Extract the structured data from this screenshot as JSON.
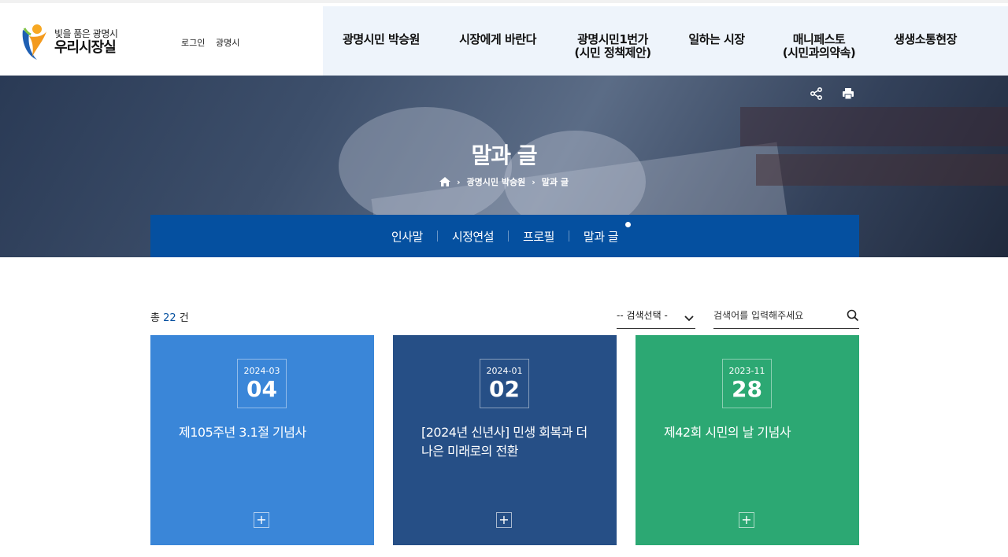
{
  "header": {
    "logo_sub": "빛을 품은 광명시",
    "logo_main": "우리시장실",
    "login_label": "로그인",
    "city_label": "광명시",
    "nav": [
      {
        "line1": "광명시민 박승원",
        "line2": ""
      },
      {
        "line1": "시장에게 바란다",
        "line2": ""
      },
      {
        "line1": "광명시민1번가",
        "line2": "(시민 정책제안)"
      },
      {
        "line1": "일하는 시장",
        "line2": ""
      },
      {
        "line1": "매니페스토",
        "line2": "(시민과의약속)"
      },
      {
        "line1": "생생소통현장",
        "line2": ""
      }
    ]
  },
  "visual": {
    "title": "말과 글",
    "breadcrumb": [
      "광명시민 박승원",
      "말과 글"
    ],
    "icons": [
      "home-icon",
      "share-icon",
      "print-icon"
    ]
  },
  "sub_nav": {
    "items": [
      "인사말",
      "시정연설",
      "프로필",
      "말과 글"
    ],
    "active_index": 3
  },
  "list": {
    "count_prefix": "총",
    "count_value": "22",
    "count_suffix": "건",
    "search_select": "-- 검색선택 -",
    "search_placeholder": "검색어를 입력해주세요"
  },
  "cards": [
    {
      "ym": "2024-03",
      "day": "04",
      "title": "제105주년 3.1절 기념사",
      "color": "#3a86d8"
    },
    {
      "ym": "2024-01",
      "day": "02",
      "title": "[2024년 신년사] 민생 회복과 더 나은 미래로의 전환",
      "color": "#264f86"
    },
    {
      "ym": "2023-11",
      "day": "28",
      "title": "제42회 시민의 날 기념사",
      "color": "#2ca873"
    }
  ],
  "plus_label": "+"
}
